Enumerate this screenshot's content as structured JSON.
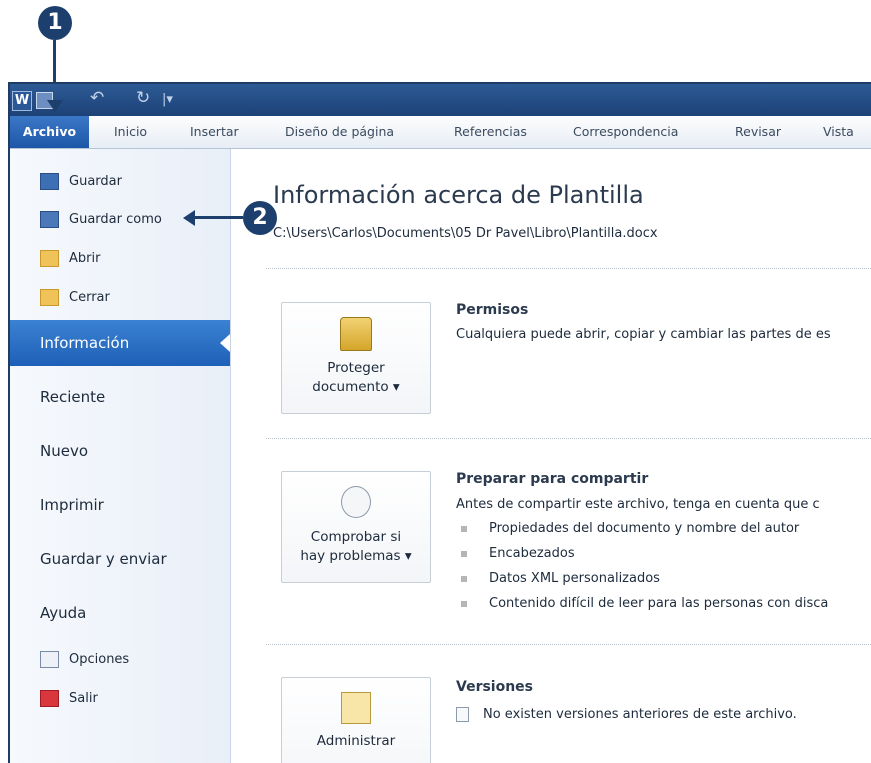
{
  "callouts": {
    "step1": "1",
    "step2": "2"
  },
  "qat": {
    "app_icon": "W"
  },
  "tabs": [
    "Archivo",
    "Inicio",
    "Insertar",
    "Diseño de página",
    "Referencias",
    "Correspondencia",
    "Revisar",
    "Vista"
  ],
  "nav": {
    "commands_top": [
      "Guardar",
      "Guardar como",
      "Abrir",
      "Cerrar"
    ],
    "items": [
      "Información",
      "Reciente",
      "Nuevo",
      "Imprimir",
      "Guardar y enviar",
      "Ayuda"
    ],
    "commands_bottom": [
      "Opciones",
      "Salir"
    ]
  },
  "info": {
    "title": "Información acerca de Plantilla",
    "path": "C:\\Users\\Carlos\\Documents\\05 Dr Pavel\\Libro\\Plantilla.docx",
    "permisos": {
      "button_line1": "Proteger",
      "button_line2": "documento",
      "heading": "Permisos",
      "text": "Cualquiera puede abrir, copiar y cambiar las partes de es"
    },
    "preparar": {
      "button_line1": "Comprobar si",
      "button_line2": "hay problemas",
      "heading": "Preparar para compartir",
      "text": "Antes de compartir este archivo, tenga en cuenta que c",
      "bullets": [
        "Propiedades del documento y nombre del autor",
        "Encabezados",
        "Datos XML personalizados",
        "Contenido difícil de leer para las personas con disca"
      ]
    },
    "versiones": {
      "button_line1": "Administrar",
      "heading": "Versiones",
      "text": "No existen versiones anteriores de este archivo."
    }
  },
  "colors": {
    "accent": "#1e60b8",
    "callout": "#1d3f6d"
  },
  "icons": [
    "word-app-icon",
    "save-icon",
    "undo-icon",
    "redo-icon",
    "save-as-icon",
    "open-folder-icon",
    "close-folder-icon",
    "lock-key-icon",
    "checklist-icon",
    "versions-icon",
    "options-icon",
    "exit-icon"
  ]
}
